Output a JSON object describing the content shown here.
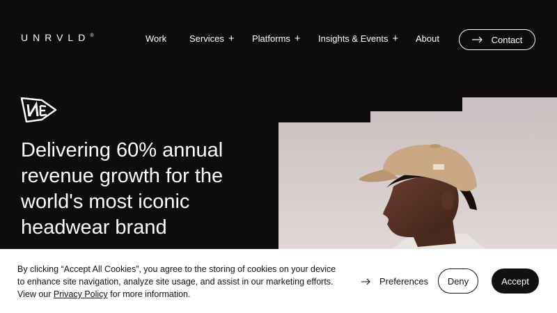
{
  "header": {
    "logo_text": "UNRVLD",
    "logo_mark": "®",
    "nav": [
      {
        "label": "Work",
        "has_submenu": false
      },
      {
        "label": "Services",
        "has_submenu": true
      },
      {
        "label": "Platforms",
        "has_submenu": true
      },
      {
        "label": "Insights & Events",
        "has_submenu": true
      },
      {
        "label": "About",
        "has_submenu": false
      }
    ],
    "submenu_symbol": "+",
    "contact_label": "Contact"
  },
  "hero": {
    "brand_logo_icon": "new-era-flag-icon",
    "headline": "Delivering 60% annual revenue growth for the world's most iconic headwear brand",
    "image_icon": "portrait-man-in-cap-image"
  },
  "cookie_banner": {
    "text_before_link": "By clicking “Accept All Cookies”, you agree to the storing of cookies on your device to enhance site navigation, analyze site usage, and assist in our marketing efforts. View our ",
    "link_label": "Privacy Policy",
    "text_after_link": " for more information.",
    "preferences_label": "Preferences",
    "deny_label": "Deny",
    "accept_label": "Accept"
  },
  "colors": {
    "background": "#0e0c0d",
    "text_light": "#ffffff",
    "banner_background": "#ffffff",
    "accent_dark": "#111111"
  }
}
